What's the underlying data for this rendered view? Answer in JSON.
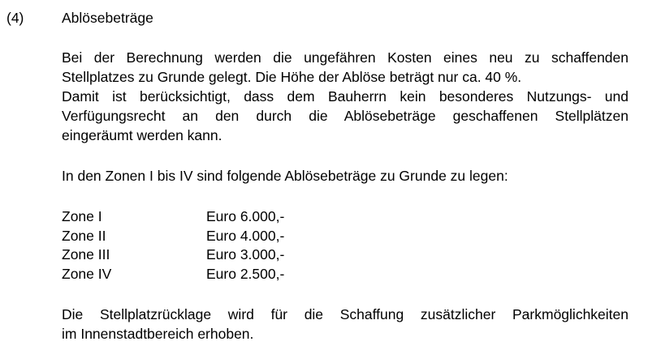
{
  "section": {
    "number": "(4)",
    "heading": "Ablösebeträge"
  },
  "paragraph1": {
    "line1": "Bei der Berechnung werden die ungefähren Kosten eines neu zu schaffenden",
    "line2": "Stellplatzes zu Grunde gelegt. Die Höhe der Ablöse beträgt nur ca. 40 %.",
    "line3": "Damit ist berücksichtigt, dass dem Bauherrn kein besonderes Nutzungs- und",
    "line4": "Verfügungsrecht an den durch die Ablösebeträge geschaffenen Stellplätzen",
    "line5": "eingeräumt werden kann."
  },
  "paragraph2": "In den Zonen I bis IV sind folgende Ablösebeträge zu Grunde zu legen:",
  "zones": [
    {
      "name": "Zone I",
      "amount": "Euro 6.000,-"
    },
    {
      "name": "Zone II",
      "amount": "Euro 4.000,-"
    },
    {
      "name": "Zone III",
      "amount": "Euro 3.000,-"
    },
    {
      "name": "Zone IV",
      "amount": "Euro 2.500,-"
    }
  ],
  "paragraph3": {
    "line1": "Die Stellplatzrücklage wird für die Schaffung zusätzlicher Parkmöglichkeiten",
    "line2": "im Innenstadtbereich erhoben."
  }
}
